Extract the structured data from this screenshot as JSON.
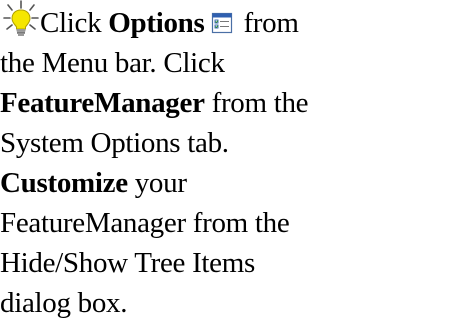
{
  "tip": {
    "icon": "lightbulb-icon",
    "s1_pre": "Click ",
    "s1_bold": "Options",
    "s1_post": " from the Menu bar. Click ",
    "s2_bold": "FeatureManager",
    "s2_post": " from the System Options tab. ",
    "s3_bold": "Customize",
    "s3_post": " your FeatureManager from the Hide/Show Tree Items dialog box.",
    "options_icon": "options-icon"
  },
  "colors": {
    "bulb_glass": "#f5e600",
    "bulb_base": "#9a9a9a",
    "rays": "#555555",
    "options_icon_accent": "#2f5fb0"
  }
}
